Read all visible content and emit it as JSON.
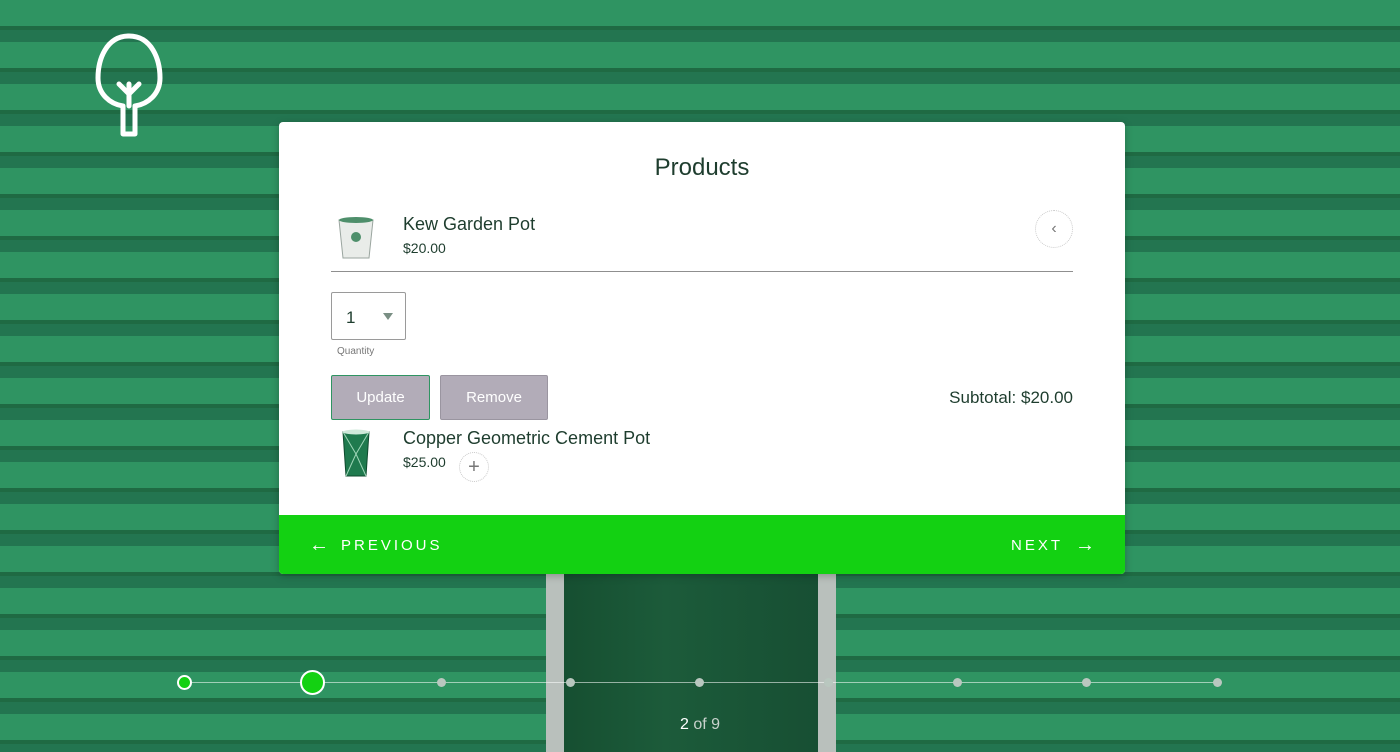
{
  "card": {
    "title": "Products"
  },
  "products": [
    {
      "name": "Kew Garden Pot",
      "price": "$20.00",
      "expanded": true,
      "collapse_icon": "chevron-left-icon"
    },
    {
      "name": "Copper Geometric Cement Pot",
      "price": "$25.00",
      "expanded": false,
      "add_icon": "plus-icon"
    }
  ],
  "quantity": {
    "value": "1",
    "label": "Quantity"
  },
  "actions": {
    "update_label": "Update",
    "remove_label": "Remove"
  },
  "subtotal": "Subtotal: $20.00",
  "navigation": {
    "previous_label": "PREVIOUS",
    "next_label": "NEXT",
    "previous_icon": "arrow-left-icon",
    "next_icon": "arrow-right-icon"
  },
  "progress": {
    "current": "2",
    "of_label": "of 9",
    "total_steps": 9,
    "current_step": 2
  },
  "colors": {
    "accent": "#13d112",
    "background": "#2c8a5a",
    "text": "#1e3d2e",
    "button": "#b2acb8"
  }
}
